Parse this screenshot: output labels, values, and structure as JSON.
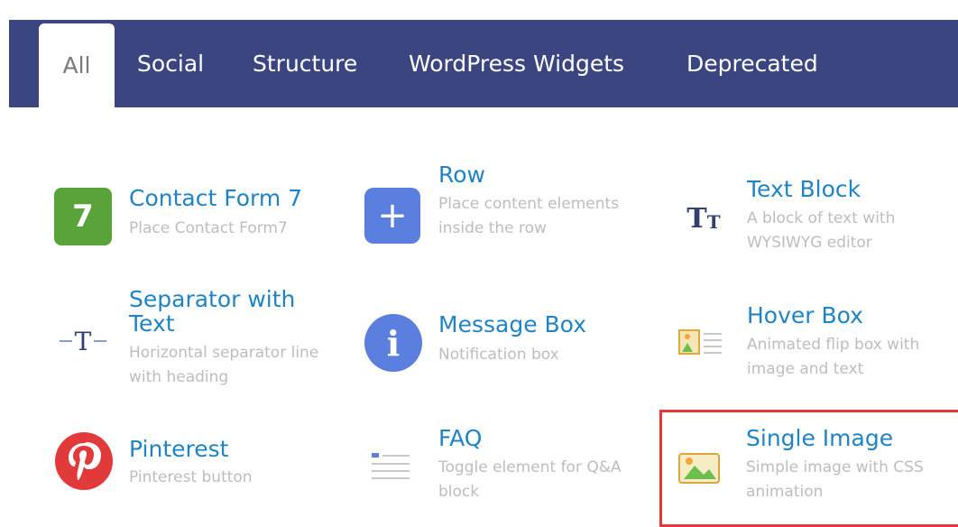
{
  "tabs": [
    {
      "label": "All"
    },
    {
      "label": "Social"
    },
    {
      "label": "Structure"
    },
    {
      "label": "WordPress Widgets"
    },
    {
      "label": "Deprecated"
    }
  ],
  "elements": {
    "contact_form_7": {
      "title": "Contact Form 7",
      "desc": "Place Contact Form7",
      "icon_glyph": "7"
    },
    "row": {
      "title": "Row",
      "desc": "Place content elements inside the row",
      "icon_glyph": "+"
    },
    "text_block": {
      "title": "Text Block",
      "desc": "A block of text with WYSIWYG editor"
    },
    "separator_with_text": {
      "title": "Separator with Text",
      "desc": "Horizontal separator line with heading"
    },
    "message_box": {
      "title": "Message Box",
      "desc": "Notification box",
      "icon_glyph": "i"
    },
    "hover_box": {
      "title": "Hover Box",
      "desc": "Animated flip box with image and text"
    },
    "pinterest": {
      "title": "Pinterest",
      "desc": "Pinterest button"
    },
    "faq": {
      "title": "FAQ",
      "desc": "Toggle element for Q&A block"
    },
    "single_image": {
      "title": "Single Image",
      "desc": "Simple image with CSS animation"
    }
  },
  "colors": {
    "tabbar": "#3b4680",
    "title": "#1f84c6",
    "highlight": "#e23a3a"
  }
}
